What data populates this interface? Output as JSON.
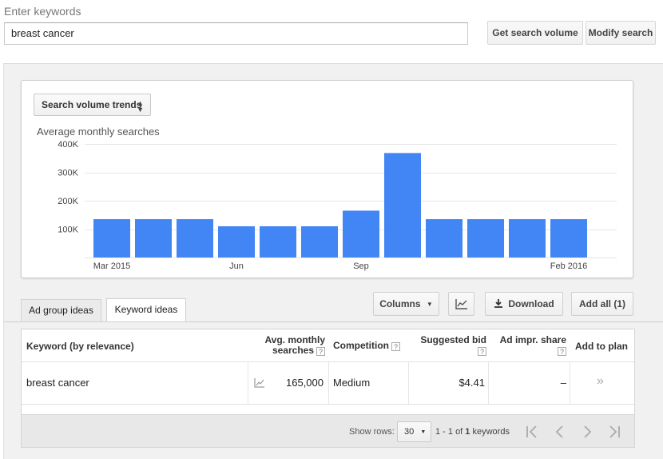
{
  "search": {
    "label": "Enter keywords",
    "value": "breast cancer",
    "get_volume_label": "Get search volume",
    "modify_label": "Modify search"
  },
  "trend": {
    "dropdown_label": "Search volume trends",
    "chart_title": "Average monthly searches"
  },
  "chart_data": {
    "type": "bar",
    "title": "Average monthly searches",
    "categories": [
      "Mar 2015",
      "Apr 2015",
      "May 2015",
      "Jun 2015",
      "Jul 2015",
      "Aug 2015",
      "Sep 2015",
      "Oct 2015",
      "Nov 2015",
      "Dec 2015",
      "Jan 2016",
      "Feb 2016"
    ],
    "tick_labels": [
      "Mar 2015",
      "",
      "",
      "Jun",
      "",
      "",
      "Sep",
      "",
      "",
      "",
      "",
      "Feb 2016"
    ],
    "values": [
      135000,
      135000,
      135000,
      110000,
      110000,
      110000,
      165000,
      368000,
      135000,
      135000,
      135000,
      135000
    ],
    "y_ticks": [
      "100K",
      "200K",
      "300K",
      "400K"
    ],
    "ylim": [
      0,
      400000
    ],
    "grid": true,
    "bar_color": "#4285f4"
  },
  "tabs": [
    {
      "label": "Ad group ideas",
      "active": false
    },
    {
      "label": "Keyword ideas",
      "active": true
    }
  ],
  "toolbar": {
    "columns_label": "Columns",
    "download_label": "Download",
    "add_all_label": "Add all (1)"
  },
  "table": {
    "headers": {
      "keyword": "Keyword (by relevance)",
      "avg_line1": "Avg. monthly",
      "avg_line2": "searches",
      "competition": "Competition",
      "bid": "Suggested bid",
      "impr": "Ad impr. share",
      "add": "Add to plan"
    },
    "help_mark": "?",
    "rows": [
      {
        "keyword": "breast cancer",
        "avg": "165,000",
        "competition": "Medium",
        "bid": "$4.41",
        "impr": "–",
        "add": "»"
      }
    ]
  },
  "footer": {
    "show_rows_label": "Show rows:",
    "rows_value": "30",
    "range_prefix": "1 - 1 of ",
    "range_total": "1",
    "range_suffix": " keywords"
  }
}
